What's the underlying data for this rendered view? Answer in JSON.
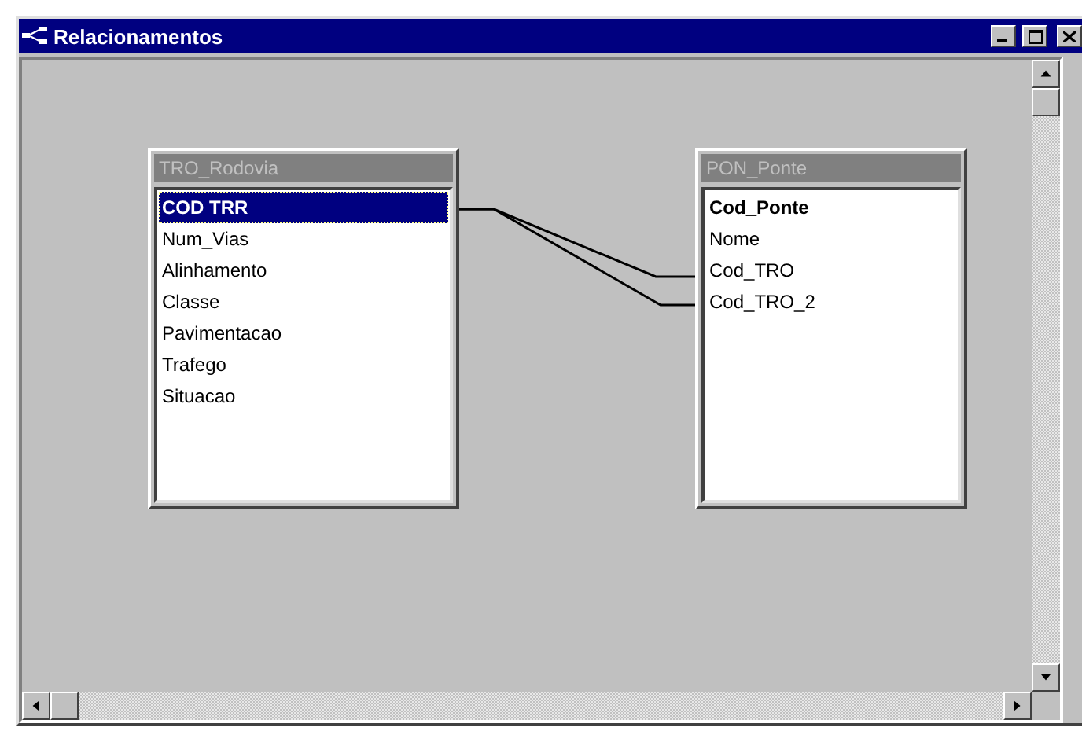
{
  "window": {
    "title": "Relacionamentos"
  },
  "tables": [
    {
      "name": "TRO_Rodovia",
      "fields": [
        {
          "name": "COD TRR",
          "selected": true,
          "primary_key": true
        },
        {
          "name": "Num_Vias",
          "selected": false,
          "primary_key": false
        },
        {
          "name": "Alinhamento",
          "selected": false,
          "primary_key": false
        },
        {
          "name": "Classe",
          "selected": false,
          "primary_key": false
        },
        {
          "name": "Pavimentacao",
          "selected": false,
          "primary_key": false
        },
        {
          "name": "Trafego",
          "selected": false,
          "primary_key": false
        },
        {
          "name": "Situacao",
          "selected": false,
          "primary_key": false
        }
      ]
    },
    {
      "name": "PON_Ponte",
      "fields": [
        {
          "name": "Cod_Ponte",
          "selected": false,
          "primary_key": true
        },
        {
          "name": "Nome",
          "selected": false,
          "primary_key": false
        },
        {
          "name": "Cod_TRO",
          "selected": false,
          "primary_key": false
        },
        {
          "name": "Cod_TRO_2",
          "selected": false,
          "primary_key": false
        }
      ]
    }
  ]
}
